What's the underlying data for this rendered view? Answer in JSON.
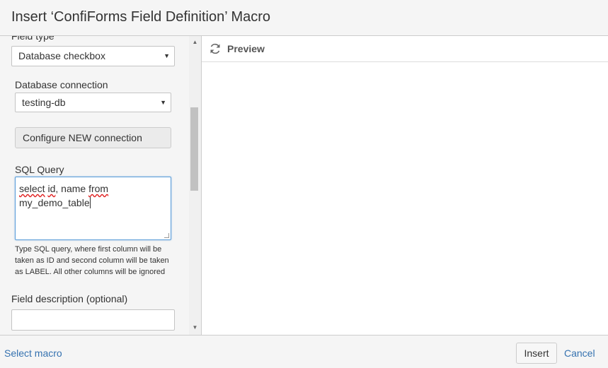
{
  "dialog": {
    "title": "Insert ‘ConfiForms Field Definition’ Macro"
  },
  "form": {
    "field_type_label": "Field type",
    "field_type_value": "Database checkbox",
    "db_connection_label": "Database connection",
    "db_connection_value": "testing-db",
    "configure_button": "Configure NEW connection",
    "sql_label": "SQL Query",
    "sql_line1_w1": "select",
    "sql_line1_w2": "id",
    "sql_line1_w3": ", name ",
    "sql_line1_w4": "from",
    "sql_line2": "my_demo_table",
    "sql_help": "Type SQL query, where first column will be taken as ID and second column will be taken as LABEL. All other columns will be ignored",
    "field_description_label": "Field description (optional)",
    "field_description_value": ""
  },
  "preview": {
    "label": "Preview",
    "icon": "refresh-icon"
  },
  "footer": {
    "select_macro": "Select macro",
    "insert": "Insert",
    "cancel": "Cancel"
  },
  "colors": {
    "link": "#3572b0",
    "focus_border": "#5b9dd9",
    "panel_bg": "#f5f5f5"
  }
}
